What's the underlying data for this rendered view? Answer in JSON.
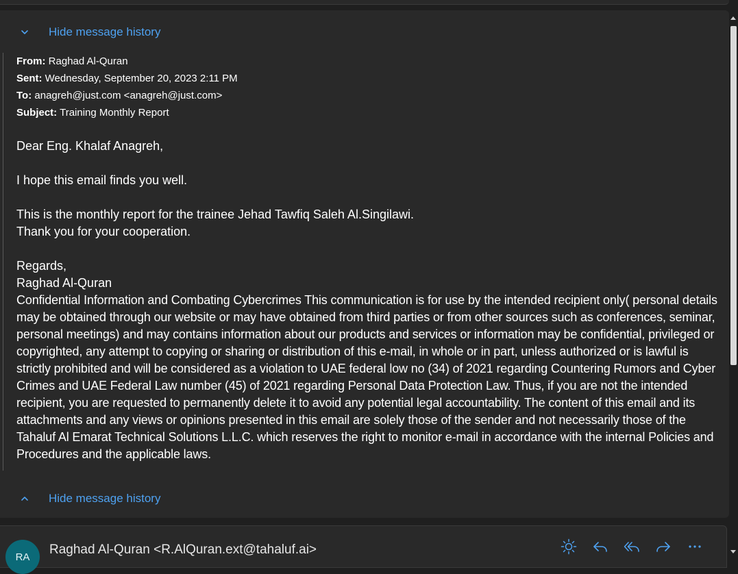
{
  "history": {
    "top_label": "Hide message history",
    "bottom_label": "Hide message history"
  },
  "headers": {
    "from_label": "From:",
    "from_value": "Raghad Al-Quran",
    "sent_label": "Sent:",
    "sent_value": "Wednesday, September 20, 2023 2:11 PM",
    "to_label": "To:",
    "to_value": "anagreh@just.com <anagreh@just.com>",
    "subject_label": "Subject:",
    "subject_value": "Training Monthly Report"
  },
  "body": {
    "greeting": "Dear Eng. Khalaf Anagreh,",
    "line1": "I hope this email finds you well.",
    "line2": "This is the monthly report for the trainee Jehad Tawfiq Saleh Al.Singilawi.",
    "line3": "Thank you for your cooperation.",
    "regards": "Regards,",
    "signature": "Raghad Al-Quran",
    "disclaimer": "Confidential Information and Combating Cybercrimes This communication is for use by the intended recipient only( personal details may be obtained through our website or may have obtained from third parties or from other sources such as conferences, seminar, personal meetings) and may contains information about our products and services or information may be confidential, privileged or copyrighted, any attempt to copying or sharing or distribution of this e-mail, in whole or in part, unless authorized or is lawful is strictly prohibited and will be considered as a violation to UAE federal low no (34) of 2021 regarding Countering Rumors and Cyber Crimes and UAE Federal Law number (45) of 2021 regarding Personal Data Protection Law. Thus, if you are not the intended recipient, you are requested to permanently delete it to avoid any potential legal accountability. The content of this email and its attachments and any views or opinions presented in this email are solely those of the sender and not necessarily those of the Tahaluf Al Emarat Technical Solutions L.L.C. which reserves the right to monitor e-mail in accordance with the internal Policies and Procedures and the applicable laws."
  },
  "next_message": {
    "avatar_initials": "RA",
    "sender": "Raghad Al-Quran <R.AlQuran.ext@tahaluf.ai>"
  },
  "icons": [
    "chevron-down-icon",
    "chevron-up-icon",
    "sun-icon",
    "reply-icon",
    "reply-all-icon",
    "forward-icon",
    "more-icon"
  ],
  "colors": {
    "background": "#1f1f1f",
    "card": "#292929",
    "link": "#4ea1f0",
    "avatar": "#0b6a78"
  }
}
